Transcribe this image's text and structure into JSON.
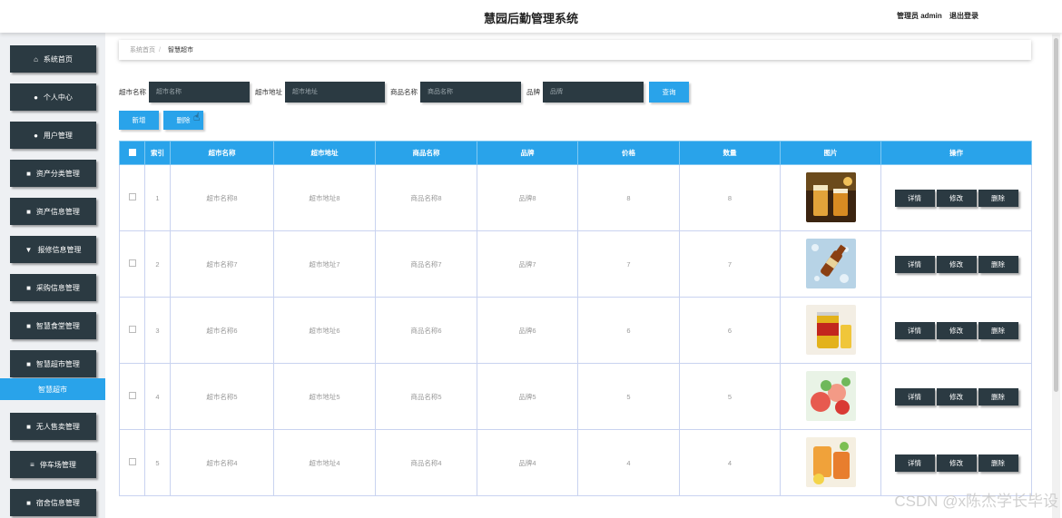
{
  "header": {
    "title": "慧园后勤管理系统",
    "user_label": "管理员 admin",
    "logout": "退出登录"
  },
  "sidebar": {
    "items": [
      {
        "label": "系统首页",
        "icon": "home-icon",
        "glyph": "⌂"
      },
      {
        "label": "个人中心",
        "icon": "user-icon",
        "glyph": "●"
      },
      {
        "label": "用户管理",
        "icon": "user-manage-icon",
        "glyph": "●"
      },
      {
        "label": "资产分类管理",
        "icon": "grid-icon",
        "glyph": "■"
      },
      {
        "label": "资产信息管理",
        "icon": "grid-icon",
        "glyph": "■"
      },
      {
        "label": "报修信息管理",
        "icon": "wrench-icon",
        "glyph": "▼"
      },
      {
        "label": "采购信息管理",
        "icon": "bag-icon",
        "glyph": "■"
      },
      {
        "label": "智慧食堂管理",
        "icon": "grid-icon",
        "glyph": "■"
      },
      {
        "label": "智慧超市管理",
        "icon": "store-icon",
        "glyph": "■"
      },
      {
        "label": "无人售卖管理",
        "icon": "grid-icon",
        "glyph": "■"
      },
      {
        "label": "停车场管理",
        "icon": "list-icon",
        "glyph": "≡"
      },
      {
        "label": "宿舍信息管理",
        "icon": "card-icon",
        "glyph": "■"
      }
    ],
    "active_sub": "智慧超市"
  },
  "breadcrumb": {
    "home": "系统首页",
    "current": "智慧超市"
  },
  "search": {
    "fields": [
      {
        "label": "超市名称",
        "placeholder": "超市名称"
      },
      {
        "label": "超市地址",
        "placeholder": "超市地址"
      },
      {
        "label": "商品名称",
        "placeholder": "商品名称"
      },
      {
        "label": "品牌",
        "placeholder": "品牌"
      }
    ],
    "button": "查询"
  },
  "actions": {
    "add": "新增",
    "delete": "删除"
  },
  "table": {
    "headers": [
      "索引",
      "超市名称",
      "超市地址",
      "商品名称",
      "品牌",
      "价格",
      "数量",
      "图片",
      "操作"
    ],
    "rows": [
      {
        "index": "1",
        "name": "超市名称8",
        "address": "超市地址8",
        "product": "商品名称8",
        "brand": "品牌8",
        "price": "8",
        "qty": "8"
      },
      {
        "index": "2",
        "name": "超市名称7",
        "address": "超市地址7",
        "product": "商品名称7",
        "brand": "品牌7",
        "price": "7",
        "qty": "7"
      },
      {
        "index": "3",
        "name": "超市名称6",
        "address": "超市地址6",
        "product": "商品名称6",
        "brand": "品牌6",
        "price": "6",
        "qty": "6"
      },
      {
        "index": "4",
        "name": "超市名称5",
        "address": "超市地址5",
        "product": "商品名称5",
        "brand": "品牌5",
        "price": "5",
        "qty": "5"
      },
      {
        "index": "5",
        "name": "超市名称4",
        "address": "超市地址4",
        "product": "商品名称4",
        "brand": "品牌4",
        "price": "4",
        "qty": "4"
      }
    ],
    "row_buttons": {
      "detail": "详情",
      "edit": "修改",
      "delete": "删除"
    }
  },
  "colors": {
    "accent": "#29a3ea",
    "dark": "#2b3a42"
  },
  "watermark": "CSDN @x陈杰学长毕设"
}
